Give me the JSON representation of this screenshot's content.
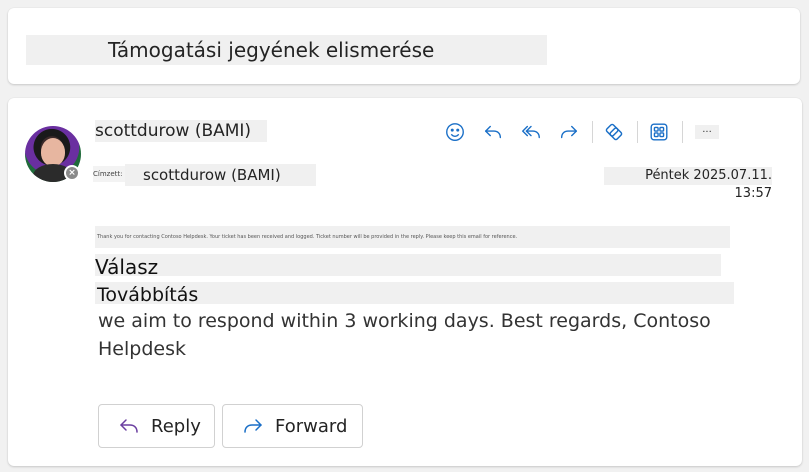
{
  "subject": "Támogatási jegyének elismerése",
  "message": {
    "sender": "scottdurow (BAMI)",
    "to_label": "Címzett:",
    "to_value": "scottdurow (BAMI)",
    "date": "Péntek 2025.07.11. 13:57",
    "preheader": "Thank you for contacting Contoso Helpdesk. Your ticket has been received and logged. Ticket number will be provided in the reply. Please keep this email for reference.",
    "heading_reply": "Válasz",
    "heading_forward": "Továbbítás",
    "body": "we aim to respond within 3 working days. Best regards, Contoso Helpdesk"
  },
  "toolbar": {
    "icons": [
      "emoji-icon",
      "reply-icon",
      "reply-all-icon",
      "forward-icon",
      "sticker-icon",
      "apps-icon"
    ],
    "more_label": "..."
  },
  "buttons": {
    "reply_label": "Reply",
    "forward_label": "Forward"
  },
  "colors": {
    "accent": "#1a6fc7",
    "reply_purple": "#6b3fa0"
  }
}
